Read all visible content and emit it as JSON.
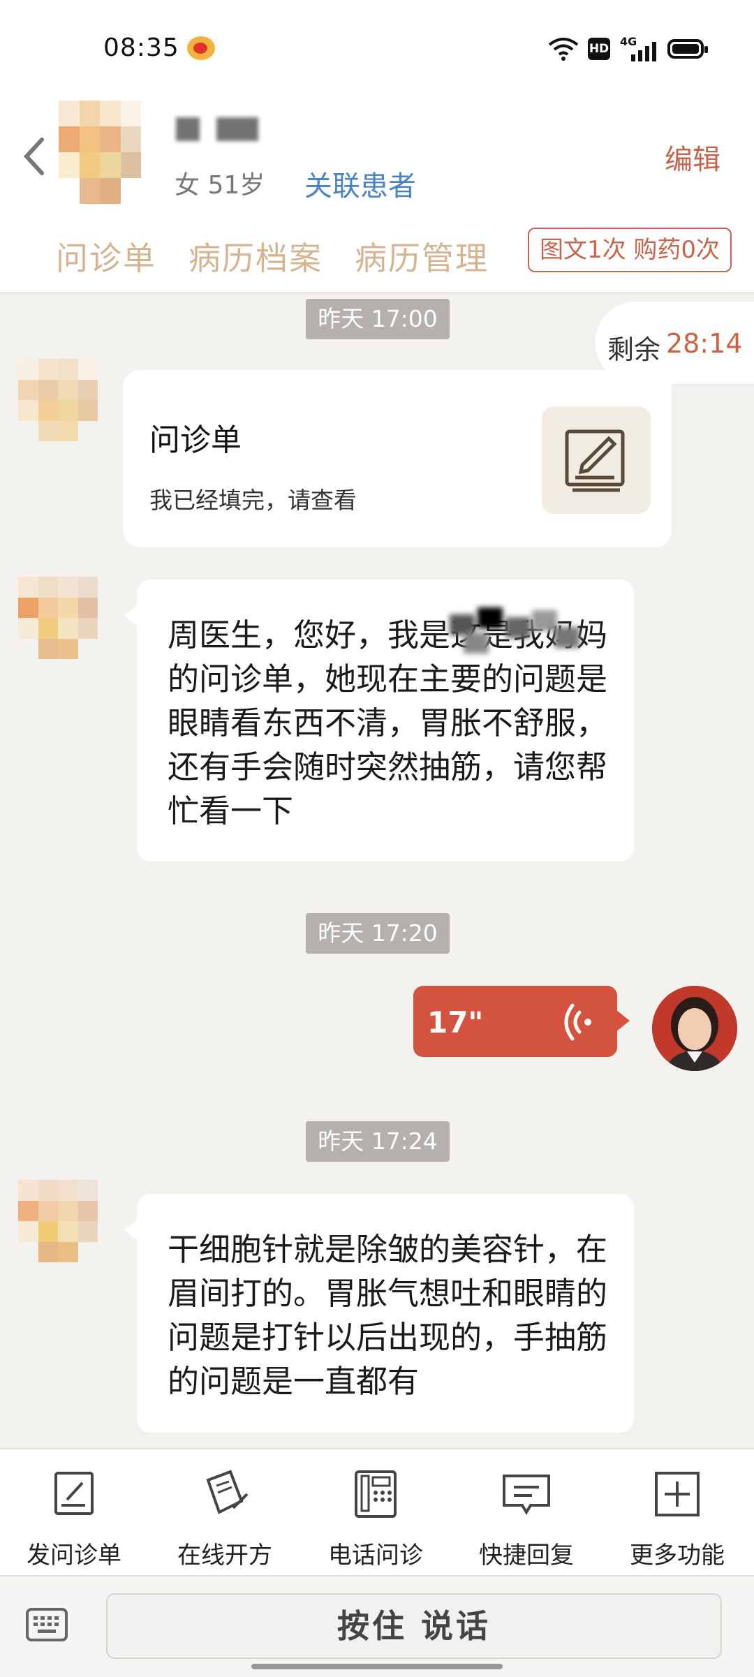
{
  "status_bar": {
    "time": "08:35",
    "network": "4G",
    "hd": "HD"
  },
  "header": {
    "patient_gender_age": "女 51岁",
    "link_patient": "关联患者",
    "edit": "编辑",
    "tabs": [
      "问诊单",
      "病历档案",
      "病历管理"
    ],
    "stats": "图文1次 购药0次"
  },
  "chat": {
    "remaining_label": "剩余",
    "remaining_time": "28:14",
    "timestamps": [
      "昨天 17:00",
      "昨天 17:20",
      "昨天 17:24"
    ],
    "form_card": {
      "title": "问诊单",
      "subtitle": "我已经填完，请查看"
    },
    "msg1": "周医生，您好，我是这是我妈妈的问诊单，她现在主要的问题是眼睛看东西不清，胃胀不舒服，还有手会随时突然抽筋，请您帮忙看一下",
    "voice": {
      "duration": "17\""
    },
    "msg2": "干细胞针就是除皱的美容针，在眉间打的。胃胀气想吐和眼睛的问题是打针以后出现的，手抽筋的问题是一直都有"
  },
  "toolbar": {
    "items": [
      {
        "label": "发问诊单",
        "icon": "form-icon"
      },
      {
        "label": "在线开方",
        "icon": "prescription-icon"
      },
      {
        "label": "电话问诊",
        "icon": "phone-icon"
      },
      {
        "label": "快捷回复",
        "icon": "quick-reply-icon"
      },
      {
        "label": "更多功能",
        "icon": "plus-icon"
      }
    ]
  },
  "input": {
    "push_to_talk": "按住 说话"
  },
  "colors": {
    "accent": "#c9644c",
    "link": "#4a84c8",
    "voice_bubble": "#d4533f",
    "tab_text": "#d5b491"
  }
}
